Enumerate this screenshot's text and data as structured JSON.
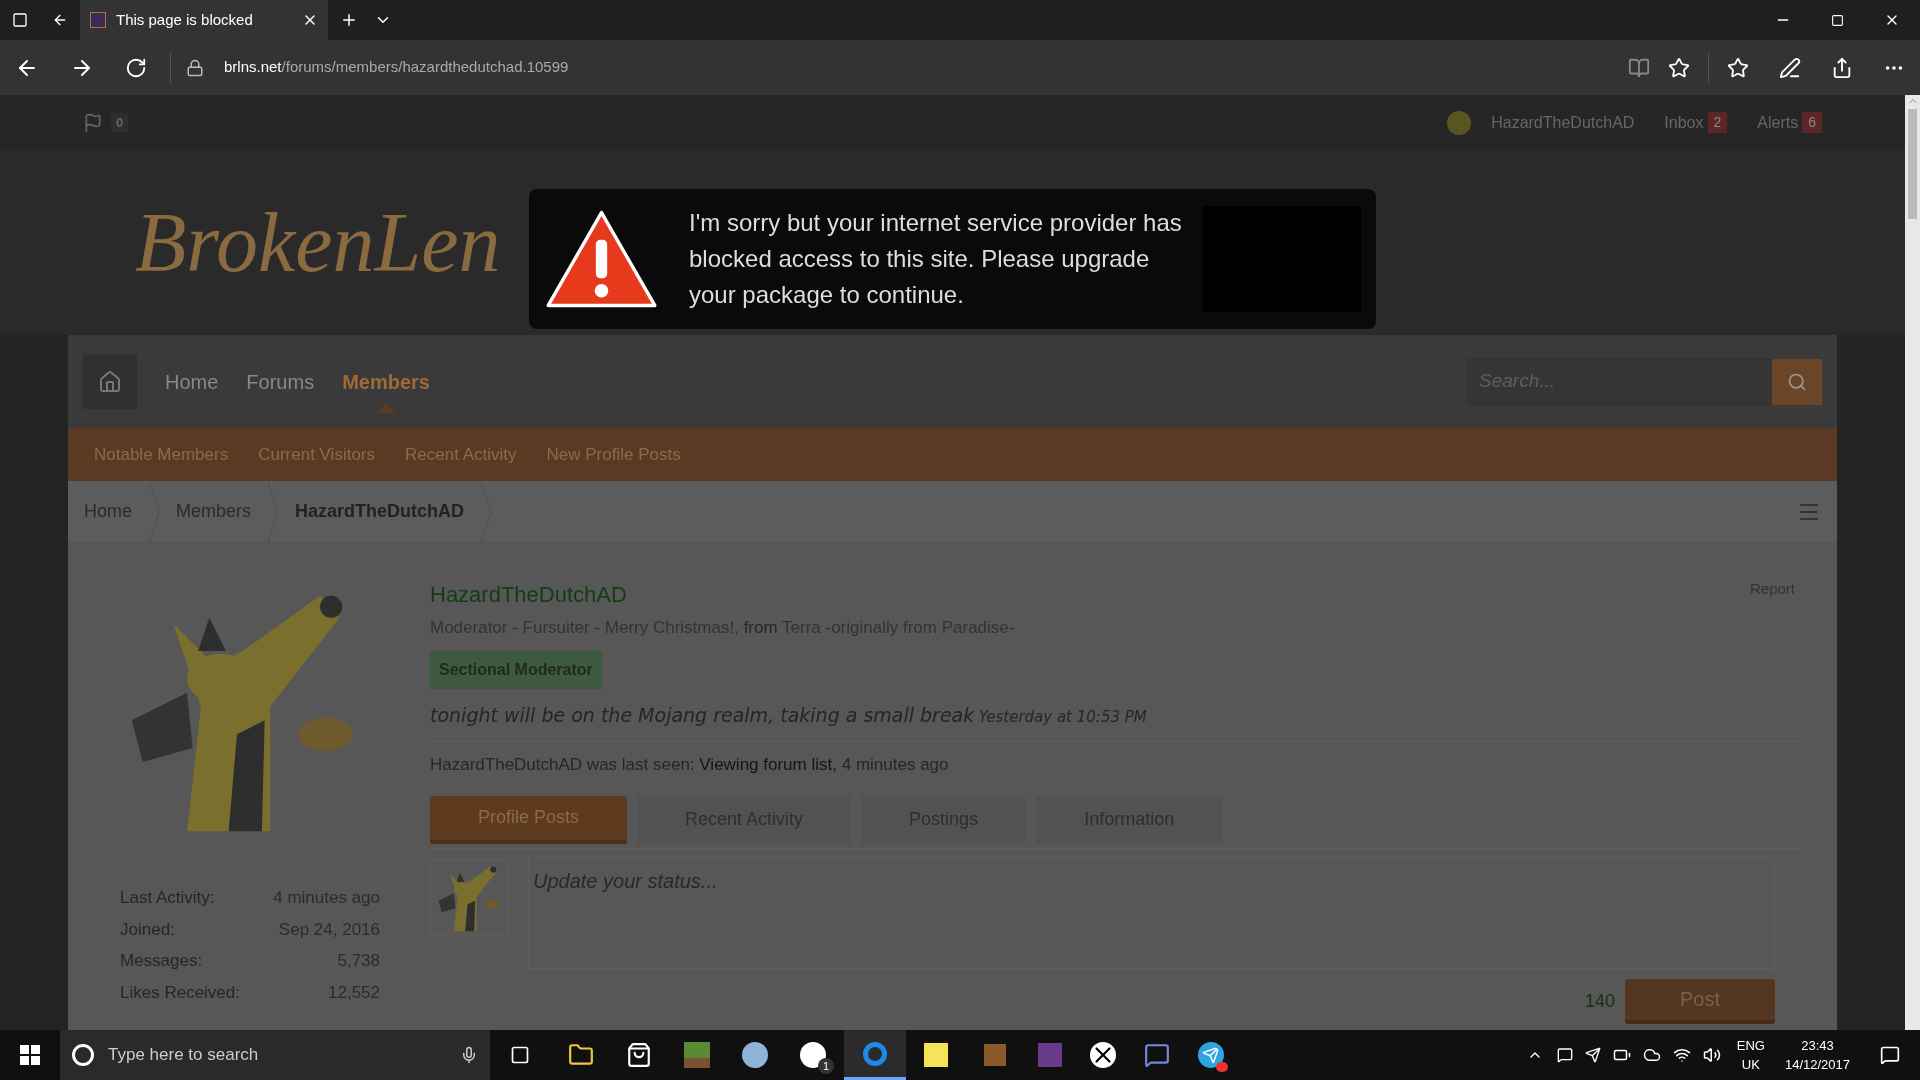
{
  "browser": {
    "tab_title": "This page is blocked",
    "url_domain": "brlns.net",
    "url_path": "/forums/members/hazardthedutchad.10599"
  },
  "sitebar": {
    "flag_count": "0",
    "username": "HazardTheDutchAD",
    "inbox": {
      "label": "Inbox",
      "count": "2"
    },
    "alerts": {
      "label": "Alerts",
      "count": "6"
    }
  },
  "logo": "BrokenLen",
  "blocked_notice": {
    "message": "I'm sorry but your internet service provider has blocked access to this site. Please upgrade your package to continue."
  },
  "nav": {
    "items": [
      {
        "label": "Home",
        "selected": false
      },
      {
        "label": "Forums",
        "selected": false
      },
      {
        "label": "Members",
        "selected": true
      }
    ],
    "search_placeholder": "Search..."
  },
  "subnav": [
    "Notable Members",
    "Current Visitors",
    "Recent Activity",
    "New Profile Posts"
  ],
  "breadcrumb": [
    {
      "label": "Home",
      "current": false
    },
    {
      "label": "Members",
      "current": false
    },
    {
      "label": "HazardTheDutchAD",
      "current": true
    }
  ],
  "profile": {
    "name": "HazardTheDutchAD",
    "title": "Moderator - Fursuiter - Merry Christmas!,",
    "from": "from",
    "location": "Terra -originally from Paradise-",
    "badge": "Sectional Moderator",
    "status": "tonight will be on the Mojang realm, taking a small break",
    "status_time": "Yesterday at 10:53 PM",
    "last_seen_name": "HazardTheDutchAD",
    "last_seen_label": "was last seen:",
    "last_seen_activity": "Viewing forum list,",
    "last_seen_time": "4 minutes ago",
    "report": "Report",
    "tabs": [
      {
        "label": "Profile Posts",
        "selected": true
      },
      {
        "label": "Recent Activity",
        "selected": false
      },
      {
        "label": "Postings",
        "selected": false
      },
      {
        "label": "Information",
        "selected": false
      }
    ],
    "status_placeholder": "Update your status...",
    "char_count": "140",
    "post_button": "Post"
  },
  "stats": [
    {
      "label": "Last Activity:",
      "value": "4 minutes ago"
    },
    {
      "label": "Joined:",
      "value": "Sep 24, 2016"
    },
    {
      "label": "Messages:",
      "value": "5,738"
    },
    {
      "label": "Likes Received:",
      "value": "12,552"
    }
  ],
  "taskbar": {
    "search_placeholder": "Type here to search",
    "skype_badge": "1",
    "language": "ENG",
    "region": "UK",
    "time": "23:43",
    "date": "14/12/2017"
  }
}
